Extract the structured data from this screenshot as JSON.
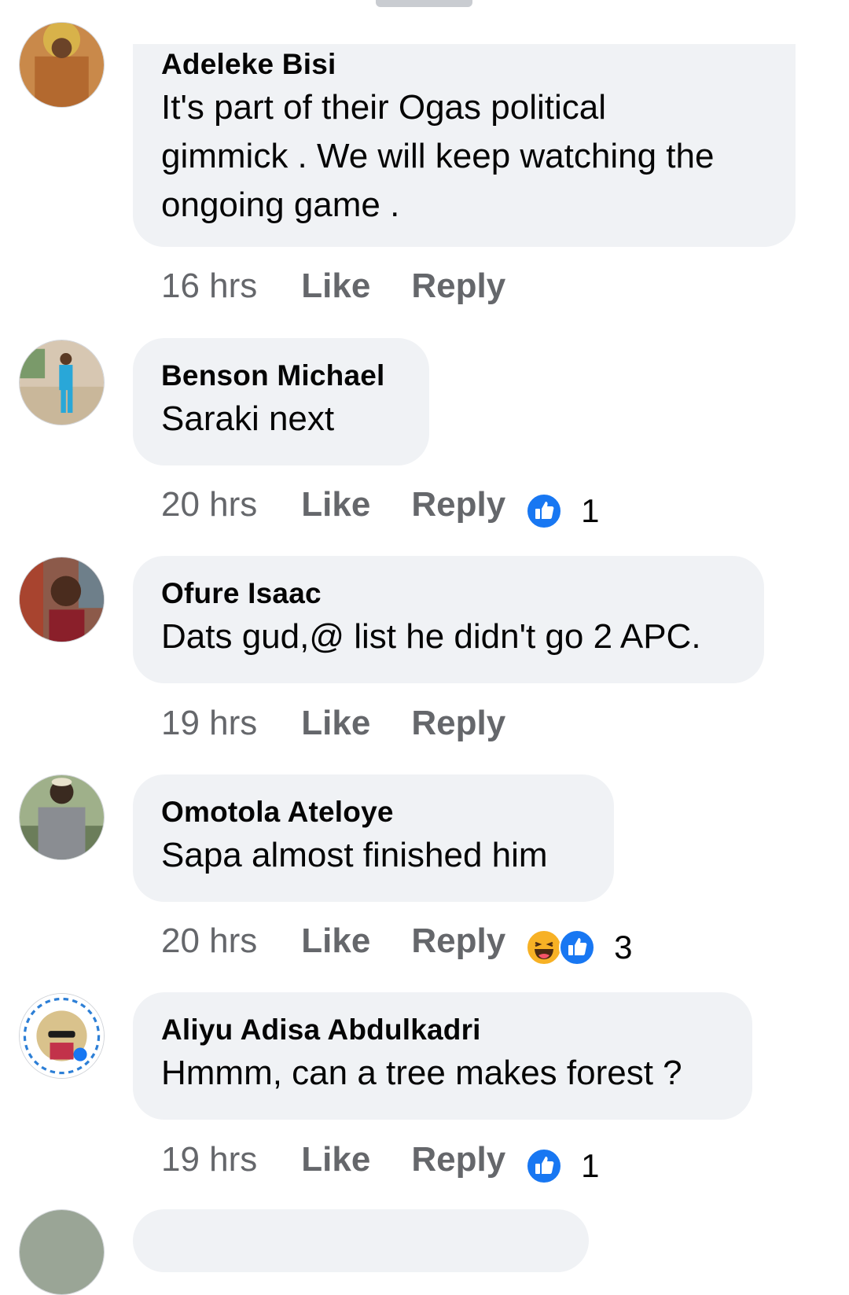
{
  "comments": [
    {
      "author": "Adeleke Bisi",
      "text_lines": [
        "It's part of their Ogas political",
        "gimmick . We will keep watching the",
        "ongoing game ."
      ],
      "time": "16 hrs",
      "like_label": "Like",
      "reply_label": "Reply",
      "reaction_count": ""
    },
    {
      "author": "Benson Michael",
      "text_lines": [
        "Saraki next"
      ],
      "time": "20 hrs",
      "like_label": "Like",
      "reply_label": "Reply",
      "reactions": [
        "like-reaction-icon"
      ],
      "reaction_count": "1"
    },
    {
      "author": "Ofure Isaac",
      "text_lines": [
        "Dats gud,@ list he didn't go 2 APC."
      ],
      "time": "19 hrs",
      "like_label": "Like",
      "reply_label": "Reply",
      "reaction_count": ""
    },
    {
      "author": "Omotola Ateloye",
      "text_lines": [
        "Sapa almost finished him"
      ],
      "time": "20 hrs",
      "like_label": "Like",
      "reply_label": "Reply",
      "reactions": [
        "haha-reaction-icon",
        "like-reaction-icon"
      ],
      "reaction_count": "3"
    },
    {
      "author": "Aliyu Adisa Abdulkadri",
      "text_lines": [
        "Hmmm, can a tree makes forest ?"
      ],
      "time": "19 hrs",
      "like_label": "Like",
      "reply_label": "Reply",
      "reactions": [
        "like-reaction-icon"
      ],
      "reaction_count": "1"
    }
  ],
  "colors": {
    "bubble": "#f0f2f5",
    "meta_text": "#65676b",
    "like_blue": "#1877f2",
    "haha_yellow": "#f7b125"
  }
}
